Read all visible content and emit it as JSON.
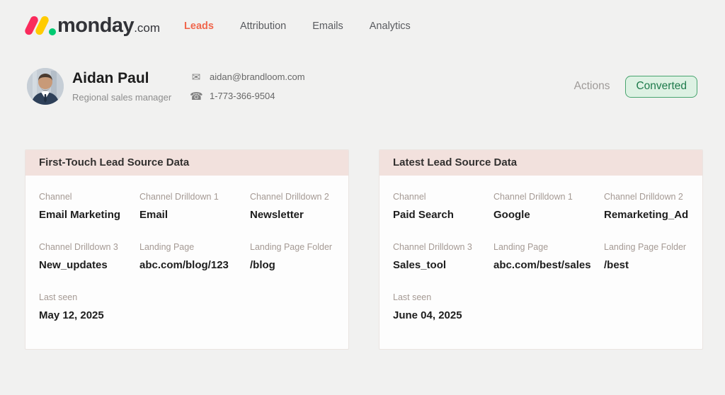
{
  "brand": {
    "name": "monday",
    "tld": ".com"
  },
  "nav": [
    {
      "label": "Leads",
      "active": true
    },
    {
      "label": "Attribution",
      "active": false
    },
    {
      "label": "Emails",
      "active": false
    },
    {
      "label": "Analytics",
      "active": false
    }
  ],
  "profile": {
    "name": "Aidan Paul",
    "role": "Regional sales manager",
    "email": "aidan@brandloom.com",
    "phone": "1-773-366-9504",
    "actions_label": "Actions",
    "status_label": "Converted"
  },
  "icons": {
    "email": "✉",
    "phone": "☎"
  },
  "cards": [
    {
      "title": "First-Touch Lead Source Data",
      "fields": [
        {
          "label": "Channel",
          "value": "Email Marketing"
        },
        {
          "label": "Channel Drilldown 1",
          "value": "Email"
        },
        {
          "label": "Channel Drilldown 2",
          "value": "Newsletter"
        },
        {
          "label": "Channel Drilldown 3",
          "value": "New_updates"
        },
        {
          "label": "Landing Page",
          "value": "abc.com/blog/123"
        },
        {
          "label": "Landing Page Folder",
          "value": "/blog"
        },
        {
          "label": "Last seen",
          "value": "May 12, 2025"
        }
      ]
    },
    {
      "title": "Latest Lead Source Data",
      "fields": [
        {
          "label": "Channel",
          "value": "Paid Search"
        },
        {
          "label": "Channel Drilldown 1",
          "value": "Google"
        },
        {
          "label": "Channel Drilldown 2",
          "value": "Remarketing_Ad"
        },
        {
          "label": "Channel Drilldown 3",
          "value": "Sales_tool"
        },
        {
          "label": "Landing Page",
          "value": "abc.com/best/sales"
        },
        {
          "label": "Landing Page Folder",
          "value": "/best"
        },
        {
          "label": "Last seen",
          "value": "June 04, 2025"
        }
      ]
    }
  ],
  "colors": {
    "page_background": "#f1f1f0",
    "brand_red": "#fa2b5c",
    "brand_yellow": "#ffcb00",
    "brand_green": "#00ca72",
    "nav_active": "#f0674d",
    "card_header_background": "#f2e1dd",
    "badge_background": "#ddf1e3",
    "badge_border": "#49a46f",
    "badge_text": "#1d7a4b",
    "field_label": "#a59a94"
  }
}
